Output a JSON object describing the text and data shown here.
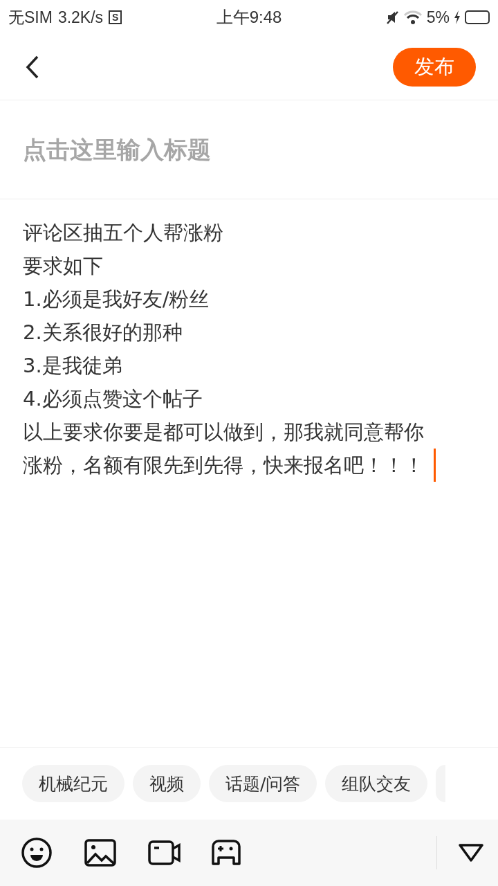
{
  "status_bar": {
    "carrier": "无SIM",
    "speed": "3.2K/s",
    "app_badge": "S",
    "time": "上午9:48",
    "battery": "5%",
    "charging": true
  },
  "header": {
    "publish": "发布"
  },
  "title": {
    "placeholder": "点击这里输入标题"
  },
  "body": {
    "lines": [
      "评论区抽五个人帮涨粉",
      "要求如下",
      "1.必须是我好友/粉丝",
      "2.关系很好的那种",
      "3.是我徒弟",
      "4.必须点赞这个帖子",
      "以上要求你要是都可以做到，那我就同意帮你",
      "涨粉，名额有限先到先得，快来报名吧！！！"
    ]
  },
  "tags": [
    {
      "label": "机械纪元"
    },
    {
      "label": "视频"
    },
    {
      "label": "话题/问答"
    },
    {
      "label": "组队交友"
    }
  ],
  "toolbar": {
    "tools": [
      {
        "kind": "emoji"
      },
      {
        "kind": "image"
      },
      {
        "kind": "video"
      },
      {
        "kind": "game"
      }
    ]
  }
}
